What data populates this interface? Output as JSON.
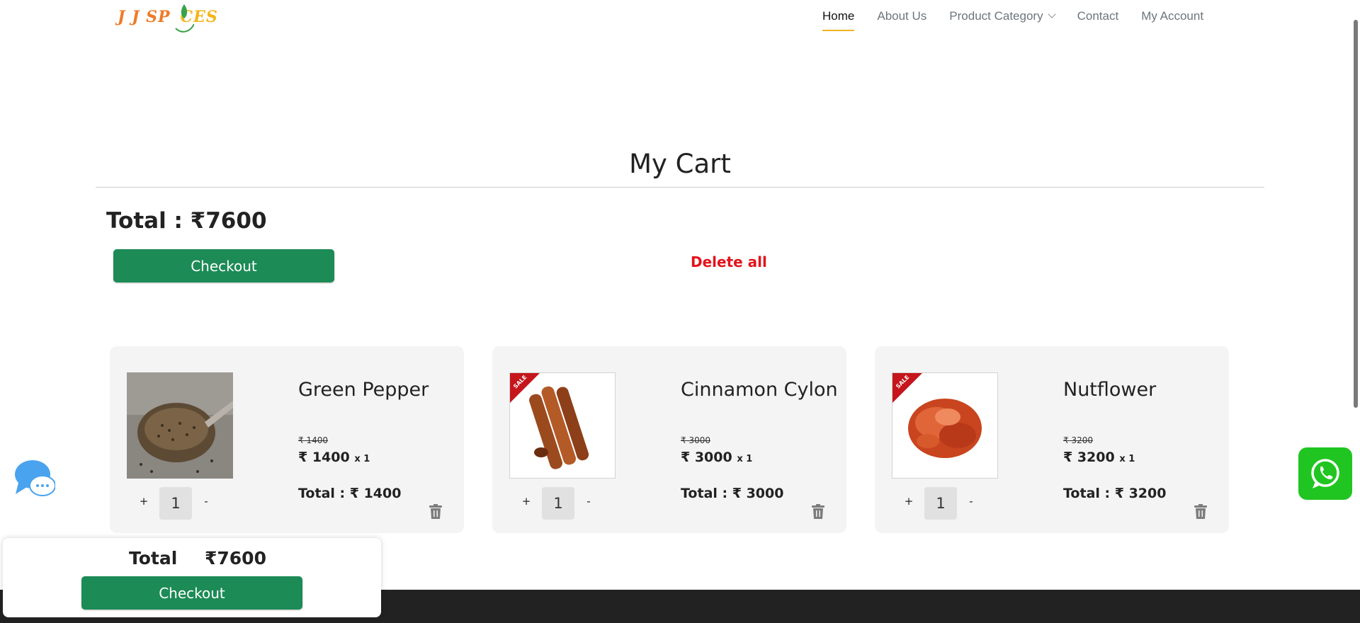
{
  "header": {
    "logo": "J J SPICES",
    "nav": [
      {
        "label": "Home",
        "active": true
      },
      {
        "label": "About Us",
        "active": false
      },
      {
        "label": "Product Category",
        "active": false,
        "dropdown": true
      },
      {
        "label": "Contact",
        "active": false
      },
      {
        "label": "My Account",
        "active": false
      }
    ]
  },
  "page": {
    "title": "My Cart",
    "total_label": "Total : ₹7600",
    "checkout_label": "Checkout",
    "delete_all_label": "Delete all"
  },
  "cart_items": [
    {
      "name": "Green Pepper",
      "old_price": "₹ 1400",
      "price": "₹ 1400",
      "qty_suffix": "x 1",
      "qty": "1",
      "total": "Total : ₹ 1400",
      "sale": false,
      "image": "spoon-of-seeds"
    },
    {
      "name": "Cinnamon Cylon",
      "old_price": "₹ 3000",
      "price": "₹ 3000",
      "qty_suffix": "x 1",
      "qty": "1",
      "total": "Total : ₹ 3000",
      "sale": true,
      "image": "cinnamon-sticks"
    },
    {
      "name": "Nutflower",
      "old_price": "₹ 3200",
      "price": "₹ 3200",
      "qty_suffix": "x 1",
      "qty": "1",
      "total": "Total : ₹ 3200",
      "sale": true,
      "image": "mace-flower"
    }
  ],
  "controls": {
    "plus": "+",
    "minus": "-",
    "sale_badge": "SALE"
  },
  "floating_panel": {
    "total_label": "Total",
    "total_value": "₹7600",
    "checkout_label": "Checkout"
  },
  "colors": {
    "accent": "#1c8b56",
    "danger": "#e3131b",
    "nav_underline": "#f0b323",
    "whatsapp": "#21c521",
    "footer": "#222222"
  }
}
